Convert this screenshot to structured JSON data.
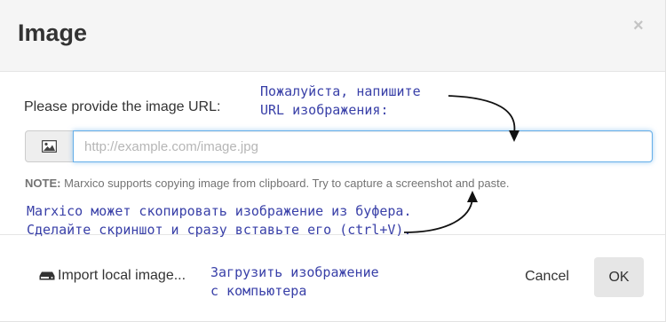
{
  "dialog": {
    "title": "Image",
    "close_label": "×"
  },
  "form": {
    "url_label": "Please provide the image URL:",
    "url_placeholder": "http://example.com/image.jpg",
    "url_value": "",
    "note_label": "NOTE:",
    "note_text": " Marxico supports copying image from clipboard. Try to capture a screenshot and paste."
  },
  "footer": {
    "import_label": "Import local image...",
    "cancel_label": "Cancel",
    "ok_label": "OK"
  },
  "annotations": {
    "url_hint_line1": "Пожалуйста, напишите",
    "url_hint_line2": "URL изображения:",
    "clipboard_hint_line1": "Marxico может скопировать изображение из буфера.",
    "clipboard_hint_line2": "Сделайте скриншот и сразу вставьте его (ctrl+V).",
    "import_hint_line1": "Загрузить изображение",
    "import_hint_line2": "с компьютера",
    "color": "#3940a8"
  },
  "icons": {
    "input_addon": "image-icon",
    "import": "hdd-icon"
  }
}
